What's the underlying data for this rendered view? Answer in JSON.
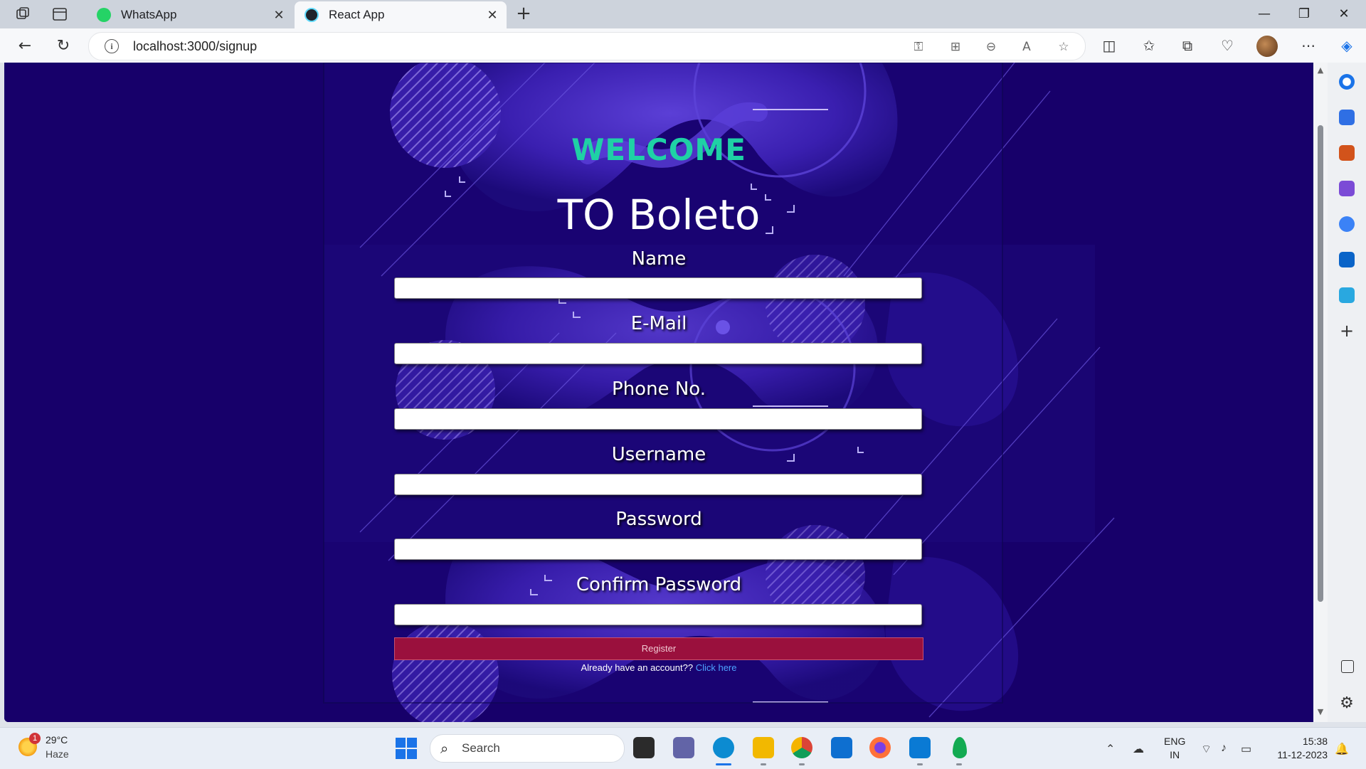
{
  "browser": {
    "tabs": [
      {
        "label": "WhatsApp",
        "active": false,
        "favicon": "whatsapp-icon"
      },
      {
        "label": "React App",
        "active": true,
        "favicon": "react-icon"
      }
    ],
    "url": "localhost:3000/signup",
    "window_controls": [
      "minimize",
      "restore",
      "close"
    ]
  },
  "page": {
    "welcome": "WELCOME",
    "subtitle": "TO Boleto",
    "fields": [
      {
        "label": "Name",
        "value": ""
      },
      {
        "label": "E-Mail",
        "value": ""
      },
      {
        "label": "Phone No.",
        "value": ""
      },
      {
        "label": "Username",
        "value": ""
      },
      {
        "label": "Password",
        "value": ""
      },
      {
        "label": "Confirm Password",
        "value": ""
      }
    ],
    "register_label": "Register",
    "login_prompt": "Already have an account??",
    "login_link": "Click here",
    "colors": {
      "background": "#17006a",
      "welcome": "#1fd1a5",
      "register": "#9a103d",
      "link": "#4da3ff"
    }
  },
  "taskbar": {
    "weather": {
      "badge": "1",
      "temp": "29°C",
      "desc": "Haze"
    },
    "search_placeholder": "Search",
    "language": {
      "line1": "ENG",
      "line2": "IN"
    },
    "clock": {
      "time": "15:38",
      "date": "11-12-2023"
    }
  }
}
